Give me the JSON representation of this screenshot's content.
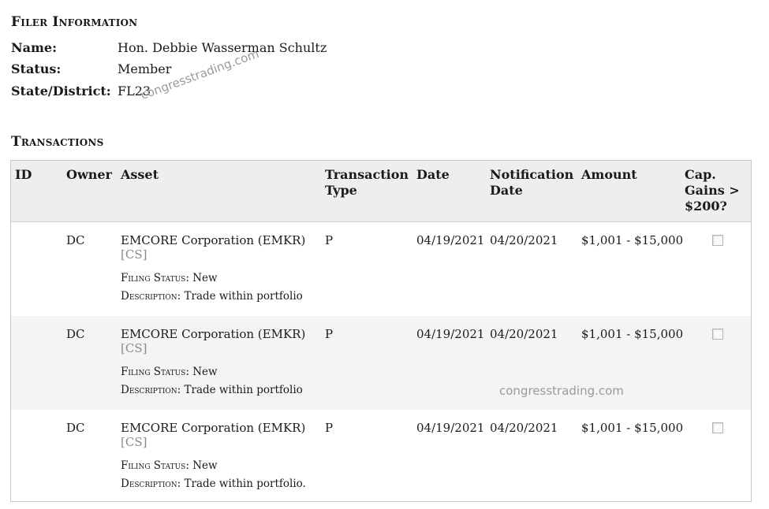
{
  "filer": {
    "heading": "Filer Information",
    "fields": [
      {
        "label": "Name:",
        "value": "Hon. Debbie Wasserman Schultz"
      },
      {
        "label": "Status:",
        "value": "Member"
      },
      {
        "label": "State/District:",
        "value": "FL23"
      }
    ]
  },
  "watermark": "congresstrading.com",
  "transactions": {
    "heading": "Transactions",
    "columns": {
      "id": "ID",
      "owner": "Owner",
      "asset": "Asset",
      "type_1": "Transaction",
      "type_2": "Type",
      "date": "Date",
      "notif_1": "Notification",
      "notif_2": "Date",
      "amount": "Amount",
      "cap_1": "Cap.",
      "cap_2": "Gains >",
      "cap_3": "$200?"
    },
    "filing_status_label": "Filing Status:",
    "description_label": "Description:",
    "rows": [
      {
        "id": "",
        "owner": "DC",
        "asset": "EMCORE Corporation (EMKR)",
        "asset_type": "[CS]",
        "filing_status": "New",
        "description": "Trade within portfolio",
        "type": "P",
        "date": "04/19/2021",
        "notification_date": "04/20/2021",
        "amount": "$1,001 - $15,000",
        "cap_gains": false
      },
      {
        "id": "",
        "owner": "DC",
        "asset": "EMCORE Corporation (EMKR)",
        "asset_type": "[CS]",
        "filing_status": "New",
        "description": "Trade within portfolio",
        "type": "P",
        "date": "04/19/2021",
        "notification_date": "04/20/2021",
        "amount": "$1,001 - $15,000",
        "cap_gains": false
      },
      {
        "id": "",
        "owner": "DC",
        "asset": "EMCORE Corporation (EMKR)",
        "asset_type": "[CS]",
        "filing_status": "New",
        "description": "Trade within portfolio.",
        "type": "P",
        "date": "04/19/2021",
        "notification_date": "04/20/2021",
        "amount": "$1,001 - $15,000",
        "cap_gains": false
      }
    ]
  }
}
